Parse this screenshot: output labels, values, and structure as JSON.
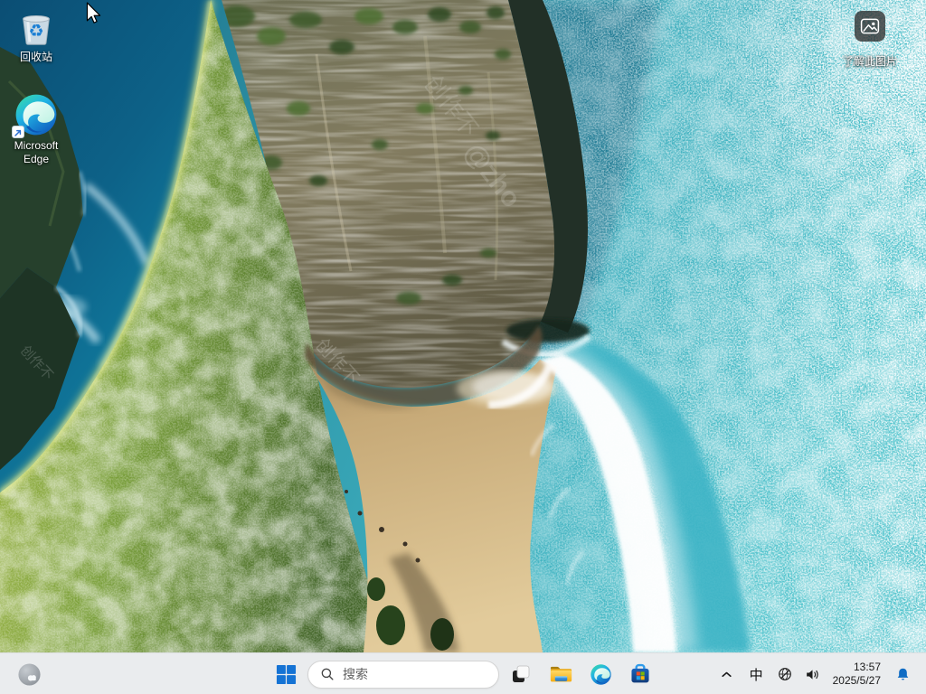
{
  "desktop": {
    "icons": [
      {
        "label": "回收站"
      },
      {
        "label": "Microsoft Edge"
      }
    ],
    "learn_about": {
      "label": "了解此图片"
    },
    "watermark": {
      "phrase": "创作不",
      "handle": "@zho"
    }
  },
  "taskbar": {
    "search": {
      "placeholder": "搜索"
    },
    "pinned_icon_names": [
      "widgets-weather-icon",
      "windows-logo-icon",
      "search-icon",
      "task-view-icon",
      "file-explorer-icon",
      "edge-icon",
      "microsoft-store-icon"
    ],
    "tray_icon_names": [
      "chevron-up-icon",
      "ime-indicator",
      "globe-no-internet-icon",
      "speaker-icon",
      "bell-icon"
    ],
    "tray": {
      "ime": "中",
      "clock": {
        "time": "13:57",
        "date": "2025/5/27"
      }
    }
  },
  "colors": {
    "taskbar_bg": "#f2f2f2",
    "accent_blue": "#1573d4",
    "bell_blue": "#0f6cc4",
    "ocean_deep": "#0b4e74",
    "ocean_turquoise": "#3fb0bf",
    "ridge_green": "#7ba03c",
    "sand": "#d6bd8d",
    "cliff": "#837c60"
  }
}
